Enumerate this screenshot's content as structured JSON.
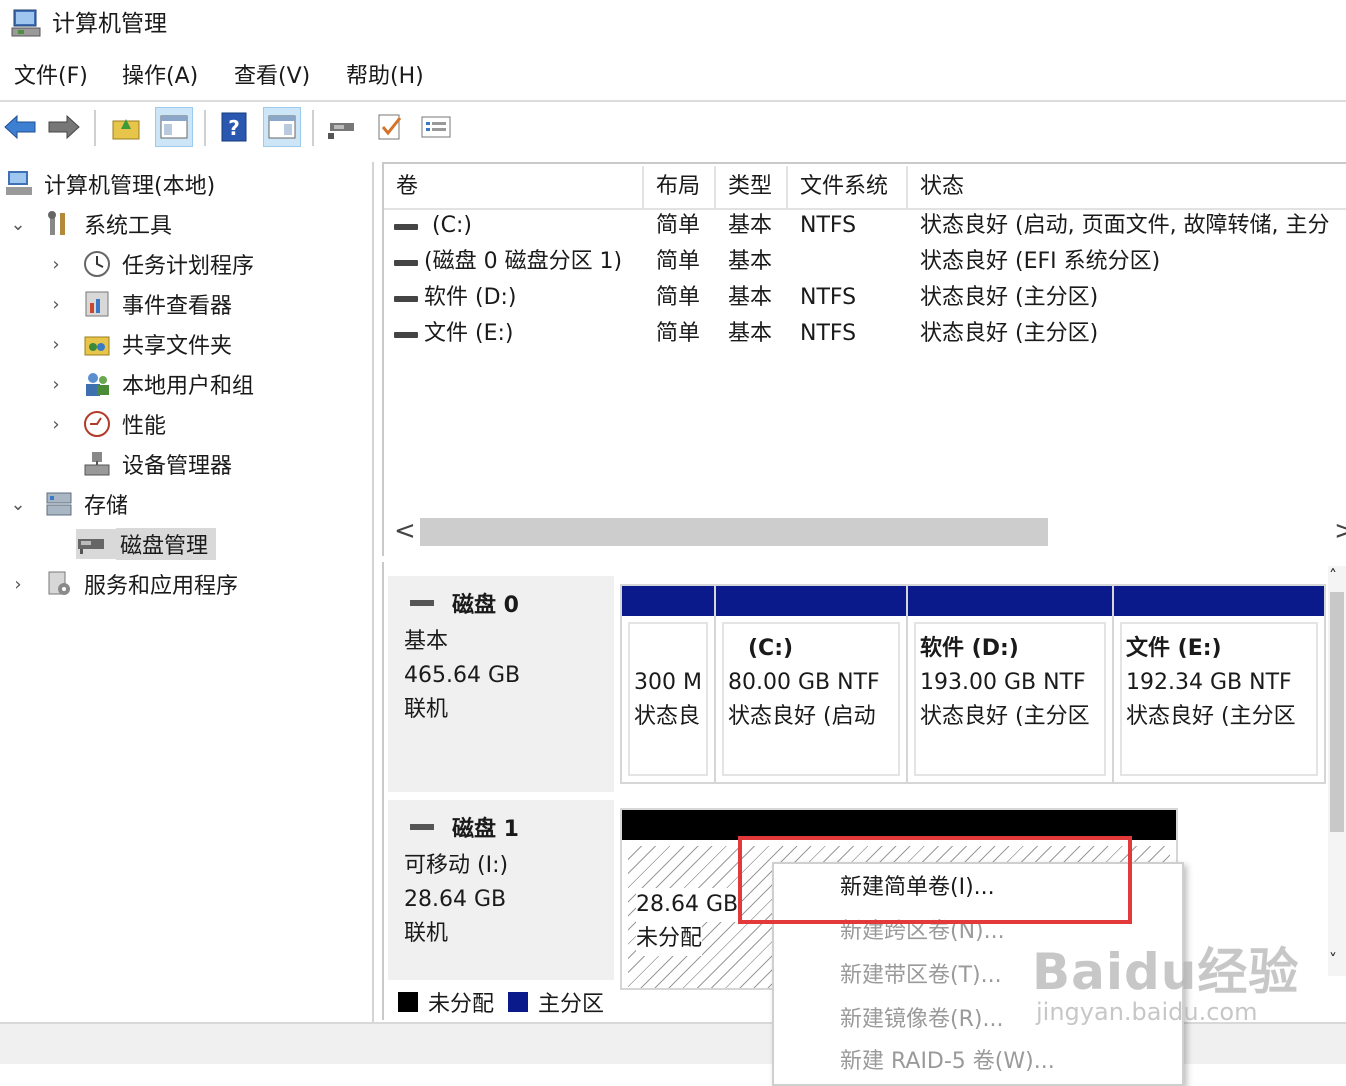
{
  "window": {
    "title": "计算机管理"
  },
  "menu": {
    "items": [
      "文件(F)",
      "操作(A)",
      "查看(V)",
      "帮助(H)"
    ]
  },
  "toolbar": {
    "buttons": [
      "back-icon",
      "forward-icon",
      "up-folder-icon",
      "show-hide-tree-icon",
      "help-icon",
      "action-pane-icon",
      "connect-icon",
      "check-icon",
      "properties-icon"
    ]
  },
  "tree": {
    "root": "计算机管理(本地)",
    "system_tools": "系统工具",
    "task_scheduler": "任务计划程序",
    "event_viewer": "事件查看器",
    "shared_folders": "共享文件夹",
    "local_users": "本地用户和组",
    "performance": "性能",
    "device_manager": "设备管理器",
    "storage": "存储",
    "disk_management": "磁盘管理",
    "services_apps": "服务和应用程序"
  },
  "volumes": {
    "headers": {
      "volume": "卷",
      "layout": "布局",
      "type": "类型",
      "fs": "文件系统",
      "status": "状态"
    },
    "rows": [
      {
        "volume": "(C:)",
        "layout": "简单",
        "type": "基本",
        "fs": "NTFS",
        "status": "状态良好 (启动, 页面文件, 故障转储, 主分"
      },
      {
        "volume": "(磁盘 0 磁盘分区 1)",
        "layout": "简单",
        "type": "基本",
        "fs": "",
        "status": "状态良好 (EFI 系统分区)"
      },
      {
        "volume": "软件 (D:)",
        "layout": "简单",
        "type": "基本",
        "fs": "NTFS",
        "status": "状态良好 (主分区)"
      },
      {
        "volume": "文件 (E:)",
        "layout": "简单",
        "type": "基本",
        "fs": "NTFS",
        "status": "状态良好 (主分区)"
      }
    ],
    "scroll_left": "<",
    "scroll_right": ">"
  },
  "disks": {
    "disk0": {
      "name": "磁盘 0",
      "kind": "基本",
      "size": "465.64 GB",
      "state": "联机",
      "partitions": [
        {
          "name": "",
          "size": "300 M",
          "status": "状态良"
        },
        {
          "name": "(C:)",
          "size": "80.00 GB NTF",
          "status": "状态良好 (启动"
        },
        {
          "name": "软件  (D:)",
          "size": "193.00 GB NTF",
          "status": "状态良好 (主分区"
        },
        {
          "name": "文件  (E:)",
          "size": "192.34 GB NTF",
          "status": "状态良好 (主分区"
        }
      ]
    },
    "disk1": {
      "name": "磁盘 1",
      "kind": "可移动 (I:)",
      "size": "28.64 GB",
      "state": "联机",
      "unallocated": {
        "size": "28.64 GB",
        "status": "未分配"
      }
    }
  },
  "legend": {
    "unallocated": "未分配",
    "primary": "主分区"
  },
  "context_menu": {
    "items": [
      {
        "label": "新建简单卷(I)...",
        "enabled": true
      },
      {
        "label": "新建跨区卷(N)...",
        "enabled": false
      },
      {
        "label": "新建带区卷(T)...",
        "enabled": false
      },
      {
        "label": "新建镜像卷(R)...",
        "enabled": false
      },
      {
        "label": "新建 RAID-5 卷(W)...",
        "enabled": false
      }
    ]
  },
  "watermark": {
    "brand": "Baidu经验",
    "url": "jingyan.baidu.com"
  },
  "colors": {
    "primary_partition": "#0b1a8a",
    "unallocated": "#000000",
    "highlight": "#e23a3a"
  }
}
